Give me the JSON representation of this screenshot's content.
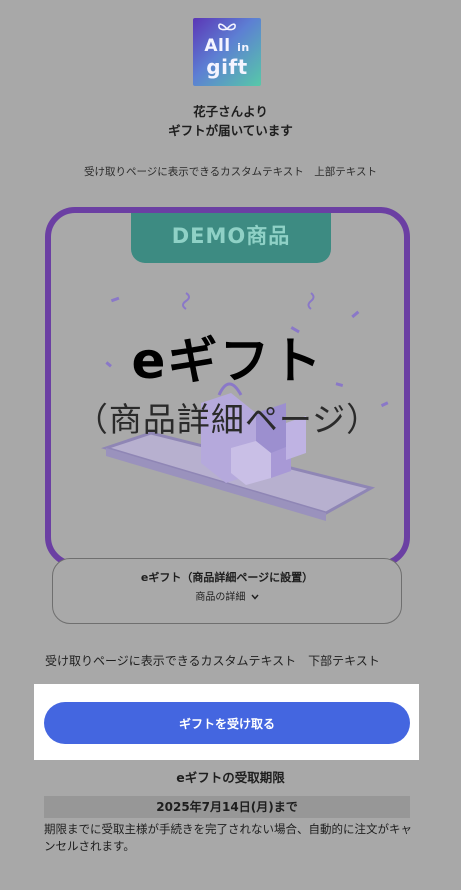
{
  "logo": {
    "line1": "All",
    "line1_small": "in",
    "line2": "gift"
  },
  "sender": {
    "line1": "花子さんより",
    "line2": "ギフトが届いています"
  },
  "custom_text_top": "受け取りページに表示できるカスタムテキスト　上部テキスト",
  "card": {
    "demo_badge": "DEMO商品",
    "title": "eギフト",
    "subtitle": "（商品詳細ページ）",
    "border_color": "#6b3fa3",
    "badge_color": "#3d8b82"
  },
  "product_info": {
    "title": "eギフト（商品詳細ページに設置）",
    "details_link": "商品の詳細"
  },
  "custom_text_bottom": "受け取りページに表示できるカスタムテキスト　下部テキスト",
  "cta": {
    "label": "ギフトを受け取る",
    "color": "#4466e0"
  },
  "deadline": {
    "title": "eギフトの受取期限",
    "date": "2025年7月14日(月)まで",
    "note": "期限までに受取主様が手続きを完了されない場合、自動的に注文がキャンセルされます。"
  }
}
